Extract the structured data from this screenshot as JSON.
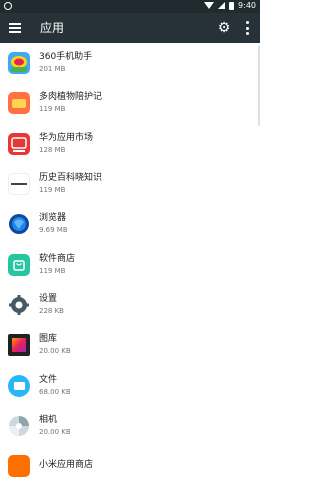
{
  "statusbar": {
    "time": "9:40"
  },
  "toolbar": {
    "title": "应用"
  },
  "apps": [
    {
      "name": "360手机助手",
      "size": "201 MB"
    },
    {
      "name": "多肉植物陪护记",
      "size": "119 MB"
    },
    {
      "name": "华为应用市场",
      "size": "128 MB"
    },
    {
      "name": "历史百科晓知识",
      "size": "119 MB"
    },
    {
      "name": "浏览器",
      "size": "9.69 MB"
    },
    {
      "name": "软件商店",
      "size": "119 MB"
    },
    {
      "name": "设置",
      "size": "228 KB"
    },
    {
      "name": "图库",
      "size": "20.00 KB"
    },
    {
      "name": "文件",
      "size": "68.00 KB"
    },
    {
      "name": "相机",
      "size": "20.00 KB"
    },
    {
      "name": "小米应用商店",
      "size": ""
    }
  ],
  "icons": [
    "360-icon",
    "succulent-icon",
    "huawei-icon",
    "history-icon",
    "browser-icon",
    "store-icon",
    "settings-icon",
    "gallery-icon",
    "files-icon",
    "camera-icon",
    "xiaomi-icon"
  ]
}
